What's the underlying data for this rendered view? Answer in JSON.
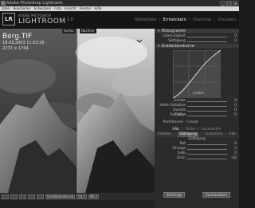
{
  "window": {
    "title": "Adobe Photoshop Lightroom",
    "controls": [
      "_",
      "□",
      "x"
    ]
  },
  "menu": [
    "Datei",
    "Bearbeiten",
    "Entwickeln",
    "Foto",
    "Ansicht",
    "Fenster",
    "Hilfe"
  ],
  "brand": {
    "badge": "LR",
    "small": "ADOBE PHOTOSHOP",
    "name": "LIGHTROOM",
    "version": "1.0"
  },
  "modules": [
    {
      "label": "Bibliothek",
      "active": false
    },
    {
      "label": "Entwickeln",
      "active": true
    },
    {
      "label": "Diashow",
      "active": false
    },
    {
      "label": "Drucken",
      "active": false
    }
  ],
  "view": {
    "before_label": "Vorher",
    "after_label": "Nachher",
    "filename": "Berg.TIF",
    "meta1": "18.03.2003 11:03:26",
    "meta2": "2272 × 1704"
  },
  "panel": {
    "histogram_title": "Histogramm",
    "tone_rows": [
      {
        "label": "Lebendigkeit",
        "value": "0"
      },
      {
        "label": "Sättigung",
        "value": "0"
      }
    ],
    "curve_title": "Gradationskurve",
    "curve_label": "Lichter",
    "curve_rows": [
      {
        "label": "Lichter",
        "value": "0"
      },
      {
        "label": "Helle Farbtöne",
        "value": "0"
      },
      {
        "label": "Dunkle Farbtöne",
        "value": "0"
      },
      {
        "label": "Tiefen",
        "value": "0"
      }
    ],
    "point_curve_label": "Punktkurve :",
    "point_curve_value": "Linear",
    "hsl_tabs": [
      "HSL",
      "Farbe",
      "Graustufen"
    ],
    "sub_tabs": [
      "Farbton",
      "Sättigung",
      "Luminanz",
      "Alle"
    ],
    "sat_title": "Sättigung",
    "sat_rows": [
      {
        "label": "Rot",
        "value": "0"
      },
      {
        "label": "Orange",
        "value": "0"
      },
      {
        "label": "Gelb",
        "value": "0"
      },
      {
        "label": "Grün",
        "value": "-42"
      }
    ],
    "btn_prev": "Vorherige",
    "btn_reset": "Zurücksetzen"
  },
  "bottombar": {
    "fields": [
      "Gradationskurve",
      "54,7",
      "80,2"
    ]
  }
}
